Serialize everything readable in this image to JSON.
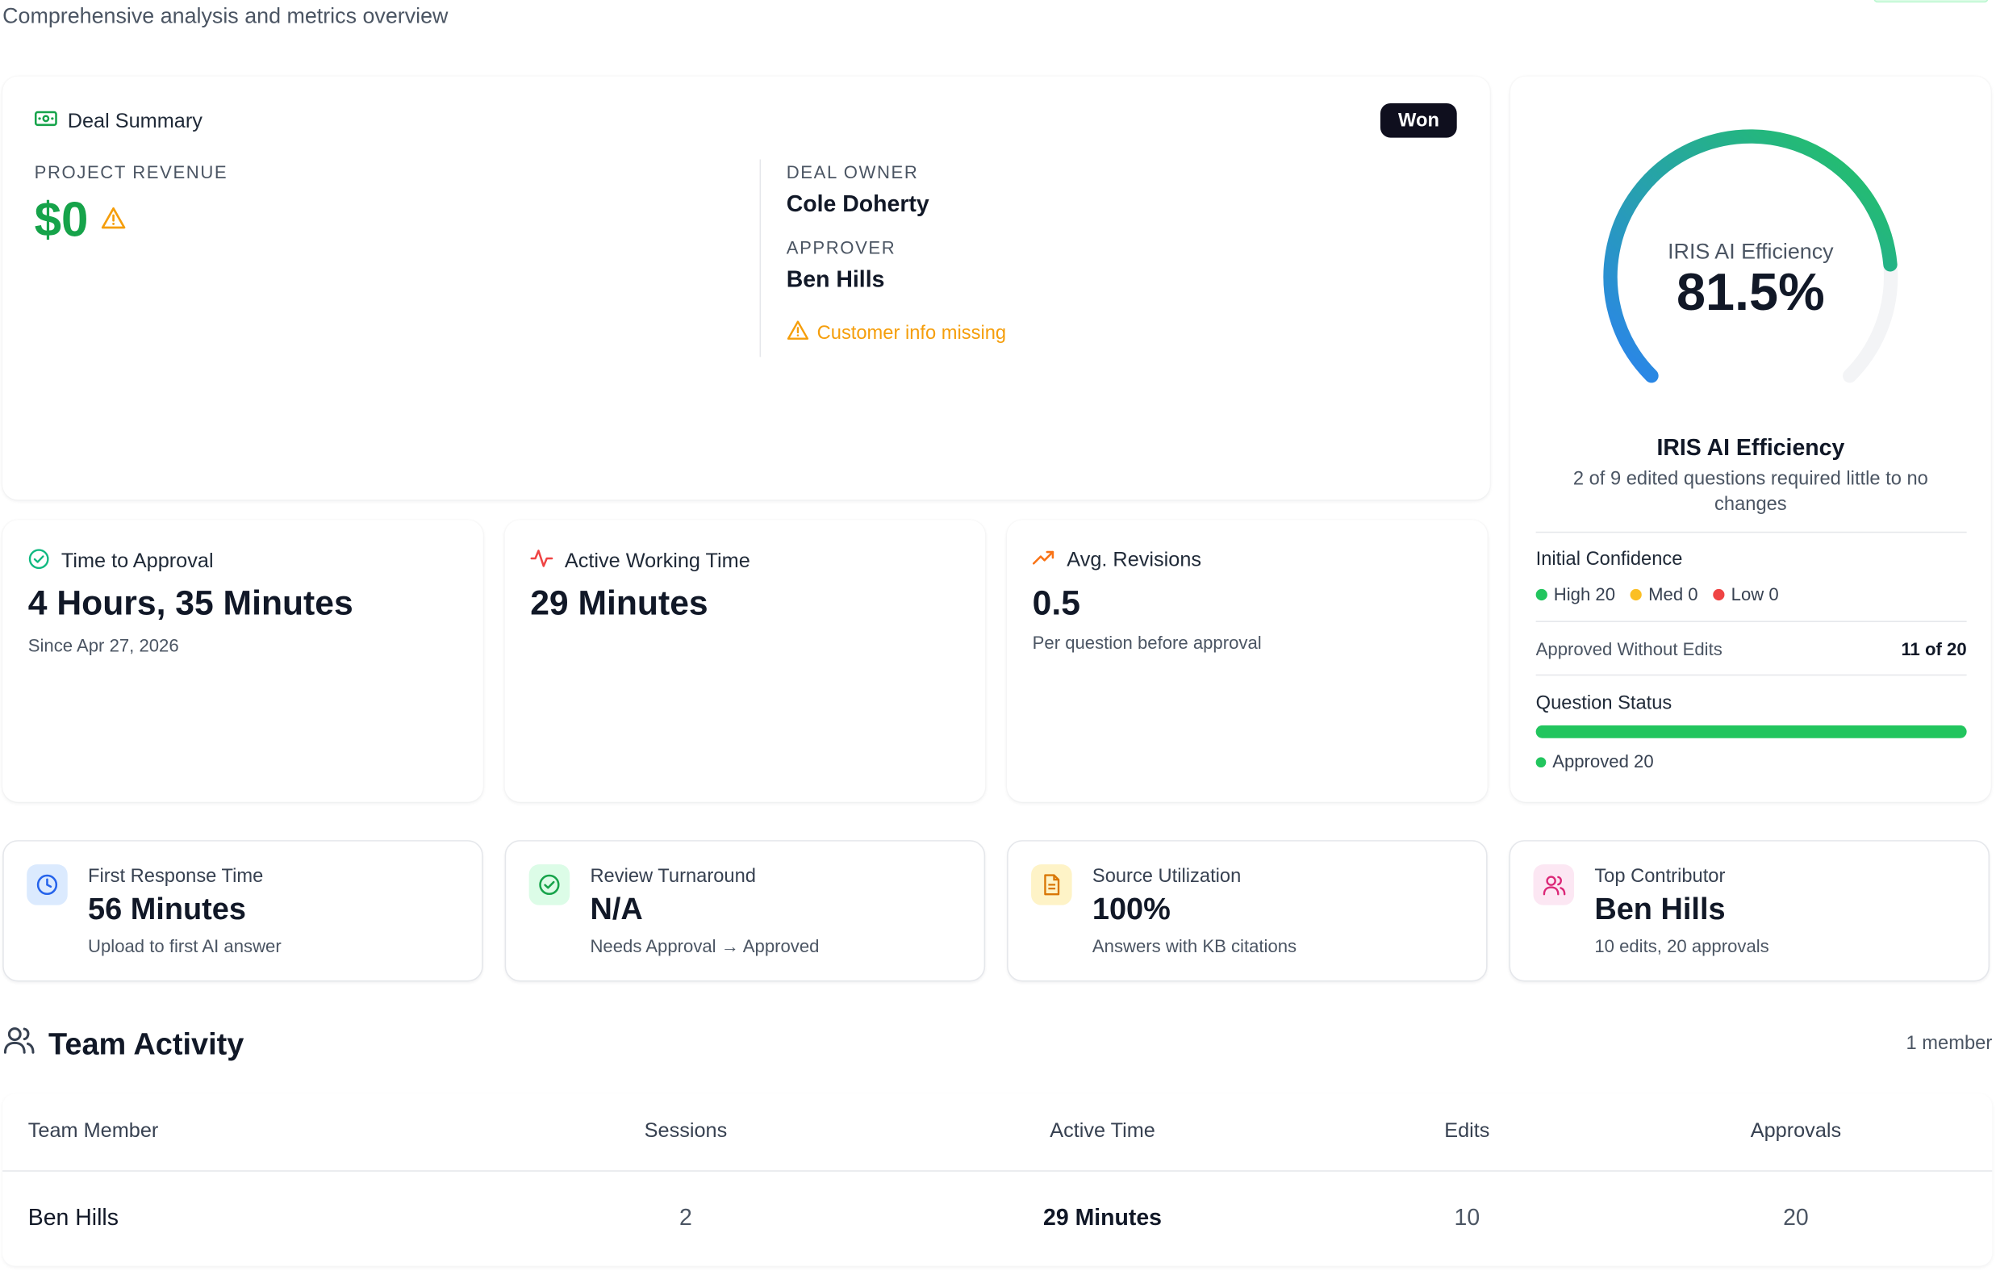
{
  "page": {
    "subtitle": "Comprehensive analysis and metrics overview"
  },
  "deal": {
    "title": "Deal Summary",
    "status": "Won",
    "revenue_label": "PROJECT REVENUE",
    "revenue_value": "$0",
    "owner_label": "DEAL OWNER",
    "owner": "Cole Doherty",
    "approver_label": "APPROVER",
    "approver": "Ben Hills",
    "warning": "Customer info missing"
  },
  "efficiency": {
    "gauge_label": "IRIS AI Efficiency",
    "gauge_value": "81.5%",
    "gauge_fraction": 0.815,
    "title": "IRIS AI Efficiency",
    "description": "2 of 9 edited questions required little to no changes",
    "confidence_label": "Initial Confidence",
    "confidence": [
      {
        "label": "High 20",
        "color": "#22c55e"
      },
      {
        "label": "Med 0",
        "color": "#fbbf24"
      },
      {
        "label": "Low 0",
        "color": "#ef4444"
      }
    ],
    "approved_label": "Approved Without Edits",
    "approved_value": "11 of 20",
    "status_label": "Question Status",
    "status_fraction": 1.0,
    "status_legend": "Approved 20",
    "colors": {
      "gauge_start": "#2b83ee",
      "gauge_end": "#22c55e",
      "track": "#f3f4f6"
    }
  },
  "stats": [
    {
      "label": "Time to Approval",
      "value": "4 Hours, 35 Minutes",
      "sub": "Since Apr 27, 2026",
      "icon": "check-circle-icon",
      "color": "#10b981"
    },
    {
      "label": "Active Working Time",
      "value": "29 Minutes",
      "sub": "",
      "icon": "activity-icon",
      "color": "#ef4444"
    },
    {
      "label": "Avg. Revisions",
      "value": "0.5",
      "sub": "Per question before approval",
      "icon": "trending-up-icon",
      "color": "#f97316"
    }
  ],
  "metrics": [
    {
      "label": "First Response Time",
      "value": "56 Minutes",
      "sub": "Upload to first AI answer",
      "icon": "clock-icon",
      "bg": "#dbeafe",
      "color": "#2563eb"
    },
    {
      "label": "Review Turnaround",
      "value": "N/A",
      "sub": "Needs Approval → Approved",
      "icon": "check-circle-icon",
      "bg": "#dcfce7",
      "color": "#16a34a"
    },
    {
      "label": "Source Utilization",
      "value": "100%",
      "sub": "Answers with KB citations",
      "icon": "document-icon",
      "bg": "#fef3c7",
      "color": "#d97706"
    },
    {
      "label": "Top Contributor",
      "value": "Ben Hills",
      "sub": "10 edits, 20 approvals",
      "icon": "users-icon",
      "bg": "#fce7f3",
      "color": "#db2777"
    }
  ],
  "team": {
    "title": "Team Activity",
    "count": "1 member",
    "columns": [
      "Team Member",
      "Sessions",
      "Active Time",
      "Edits",
      "Approvals"
    ],
    "rows": [
      [
        "Ben Hills",
        "2",
        "29 Minutes",
        "10",
        "20"
      ]
    ]
  }
}
